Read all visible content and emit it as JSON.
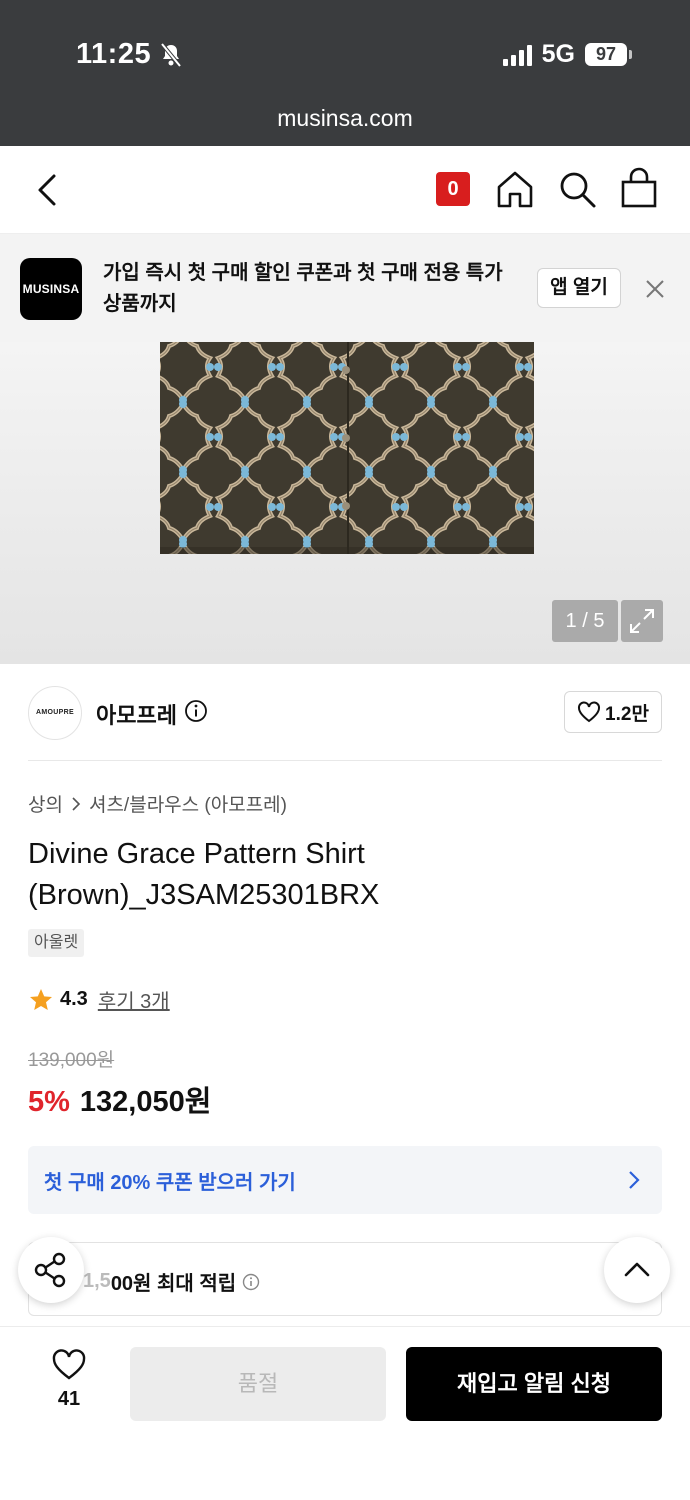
{
  "status_bar": {
    "time": "11:25",
    "network": "5G",
    "battery": "97",
    "url": "musinsa.com"
  },
  "nav": {
    "cart_count": "0",
    "icons": [
      "back-icon",
      "home-icon",
      "search-icon",
      "bag-icon"
    ]
  },
  "app_banner": {
    "logo_text": "MUSINSA",
    "message": "가입 즉시 첫 구매 할인 쿠폰과 첫 구매 전용 특가 상품까지",
    "open_label": "앱 열기"
  },
  "gallery": {
    "counter": "1 / 5"
  },
  "brand": {
    "logo_text": "AMOUPRE",
    "name": "아모프레",
    "likes": "1.2만"
  },
  "breadcrumb": {
    "category": "상의",
    "subcategory": "셔츠/블라우스 (아모프레)"
  },
  "product": {
    "title": "Divine Grace Pattern Shirt (Brown)_J3SAM25301BRX",
    "tag": "아울렛",
    "rating": "4.3",
    "review_link": "후기 3개",
    "original_price": "139,000원",
    "discount": "5%",
    "price": "132,050원"
  },
  "coupon": {
    "label": "첫 구매 20% 쿠폰 받으러 가기"
  },
  "points": {
    "faded_prefix": "1,5",
    "label": "00원 최대 적립"
  },
  "bottom_bar": {
    "wish_count": "41",
    "soldout_label": "품절",
    "restock_label": "재입고 알림 신청"
  },
  "colors": {
    "accent_red": "#e0252c",
    "badge_red": "#d81e1e",
    "link_blue": "#2b5fd9",
    "shirt_brown": "#3f3a2f",
    "pattern_tan": "#c9b79a",
    "pattern_blue": "#7bb8d8"
  }
}
